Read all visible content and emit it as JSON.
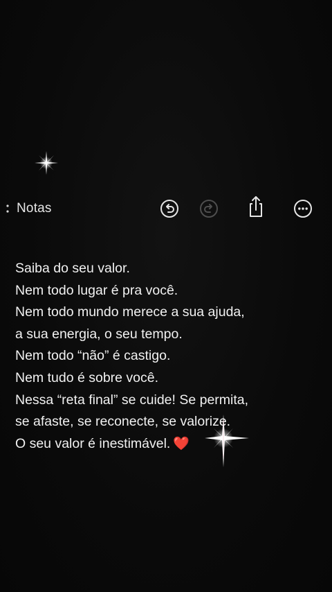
{
  "toolbar": {
    "back_label": "Notas",
    "undo_icon": "undo-circle-icon",
    "redo_icon": "redo-circle-icon",
    "share_icon": "share-icon",
    "more_icon": "more-circle-icon"
  },
  "note": {
    "lines": [
      "Saiba do seu valor.",
      "Nem todo lugar é pra você.",
      "Nem todo mundo merece a sua ajuda,",
      "a sua energia, o seu tempo.",
      "Nem todo “não” é castigo.",
      "Nem tudo é sobre você.",
      "Nessa “reta final” se cuide! Se permita,",
      "se afaste, se reconecte, se valorize.",
      "O seu valor é inestimável."
    ],
    "emoji": "❤️"
  },
  "colors": {
    "background": "#0b0b0b",
    "text": "#f1f1f1",
    "icon": "#e6e6e6",
    "icon_disabled": "#5a5a5a",
    "heart": "#e0262e"
  }
}
